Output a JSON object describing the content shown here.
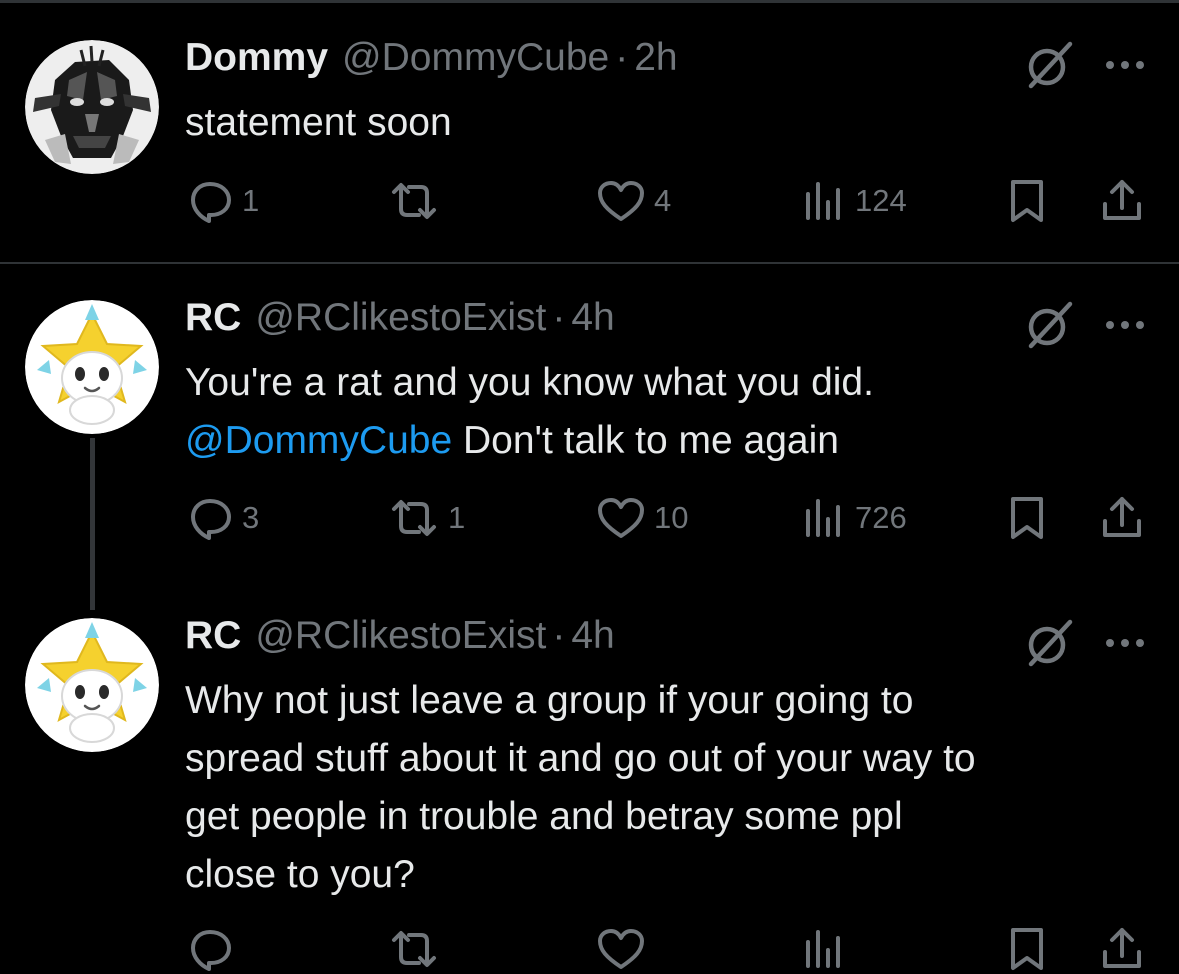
{
  "colors": {
    "background": "#000000",
    "text_primary": "#e7e9ea",
    "text_secondary": "#71767b",
    "mention": "#1d9bf0",
    "divider": "#2f3336"
  },
  "tweets": [
    {
      "display_name": "Dommy",
      "handle": "@DommyCube",
      "separator": "·",
      "time": "2h",
      "text_lines": [
        "statement soon"
      ],
      "avatar_icon": "masked-figure-avatar",
      "menu_icons": [
        "grok-icon",
        "more-icon"
      ],
      "stats": {
        "replies": "1",
        "reposts": "",
        "likes": "4",
        "views": "124"
      }
    },
    {
      "display_name": "RC",
      "handle": "@RClikestoExist",
      "separator": "·",
      "time": "4h",
      "text_line1": "You're a rat and you know what you did.",
      "mention": "@DommyCube",
      "text_line2_rest": " Don't talk to me again",
      "avatar_icon": "yellow-star-creature-avatar",
      "menu_icons": [
        "grok-icon",
        "more-icon"
      ],
      "stats": {
        "replies": "3",
        "reposts": "1",
        "likes": "10",
        "views": "726"
      }
    },
    {
      "display_name": "RC",
      "handle": "@RClikestoExist",
      "separator": "·",
      "time": "4h",
      "text_lines": [
        "Why not just leave a group if your going to",
        "spread stuff about it and go out of your way to",
        "get people in trouble and betray some ppl",
        "close to you?"
      ],
      "avatar_icon": "yellow-star-creature-avatar",
      "menu_icons": [
        "grok-icon",
        "more-icon"
      ]
    }
  ],
  "action_icons": [
    "reply-icon",
    "repost-icon",
    "like-icon",
    "views-icon",
    "bookmark-icon",
    "share-icon"
  ]
}
